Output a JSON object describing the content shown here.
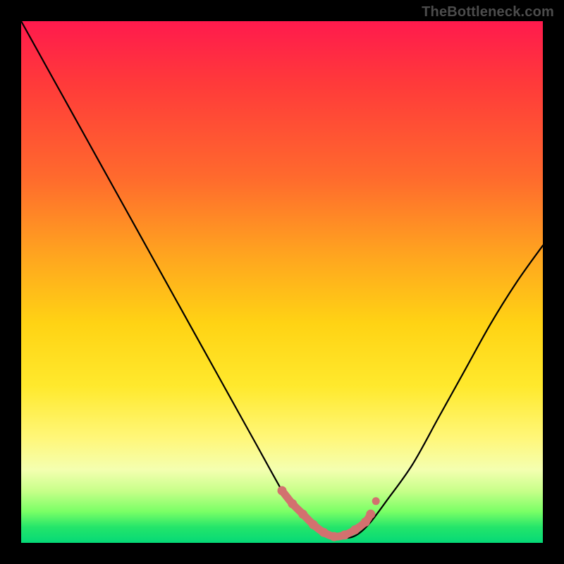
{
  "watermark": "TheBottleneck.com",
  "chart_data": {
    "type": "line",
    "title": "",
    "xlabel": "",
    "ylabel": "",
    "xlim": [
      0,
      100
    ],
    "ylim": [
      0,
      100
    ],
    "series": [
      {
        "name": "curve",
        "x": [
          0,
          5,
          10,
          15,
          20,
          25,
          30,
          35,
          40,
          45,
          50,
          52,
          55,
          58,
          60,
          63,
          65,
          67,
          70,
          75,
          80,
          85,
          90,
          95,
          100
        ],
        "y": [
          100,
          91,
          82,
          73,
          64,
          55,
          46,
          37,
          28,
          19,
          10,
          7,
          4,
          2,
          1,
          1,
          2,
          4,
          8,
          15,
          24,
          33,
          42,
          50,
          57
        ],
        "color": "#000000"
      },
      {
        "name": "markers",
        "x": [
          50,
          52,
          54,
          56,
          58,
          60,
          62,
          64,
          66,
          67
        ],
        "y": [
          10.0,
          7.5,
          5.5,
          3.5,
          2.0,
          1.2,
          1.5,
          2.5,
          4.0,
          5.5
        ],
        "color": "#d2716f"
      }
    ],
    "background_gradient": {
      "top": "#ff1a4d",
      "mid": "#ffe92d",
      "bottom": "#05d977"
    }
  }
}
